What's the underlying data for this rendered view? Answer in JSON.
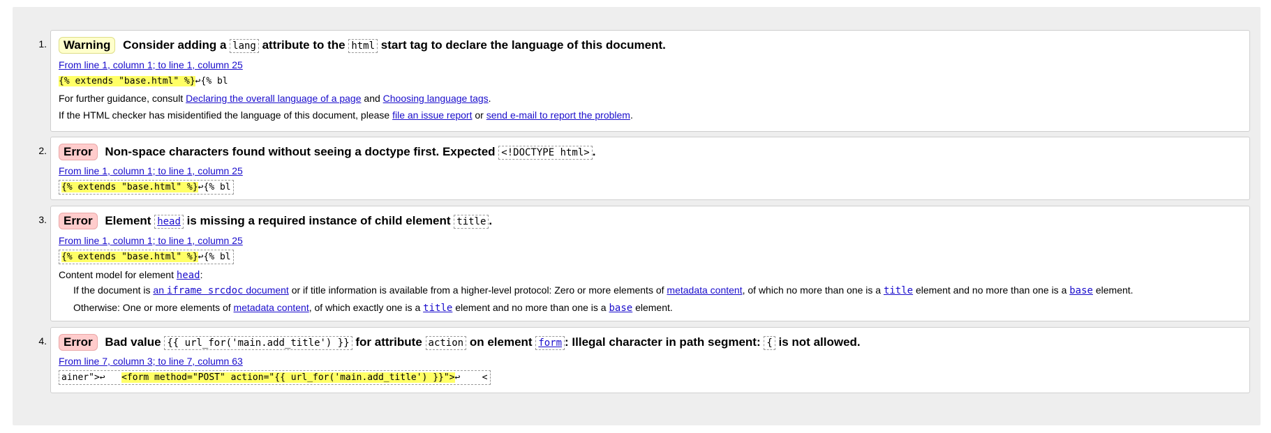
{
  "messages": [
    {
      "number": "1.",
      "type_label": "Warning",
      "title_a": "Consider adding a",
      "code1": "lang",
      "title_b": "attribute to the",
      "code2": "html",
      "title_c": "start tag to declare the language of this document.",
      "location": "From line 1, column 1; to line 1, column 25",
      "extract_highlight": "{% extends \"base.html\" %}",
      "extract_rest": "↩{% bl",
      "guidance_prefix": "For further guidance, consult",
      "guidance_link1": "Declaring the overall language of a page",
      "guidance_and": "and",
      "guidance_link2": "Choosing language tags",
      "guidance_end": ".",
      "misid_prefix": "If the HTML checker has misidentified the language of this document, please",
      "misid_link1": "file an issue report",
      "misid_or": "or",
      "misid_link2": "send e-mail to report the problem",
      "misid_end": "."
    },
    {
      "number": "2.",
      "type_label": "Error",
      "title_a": "Non-space characters found without seeing a doctype first. Expected",
      "code1": "<!DOCTYPE html>",
      "title_end": ".",
      "location": "From line 1, column 1; to line 1, column 25",
      "extract_highlight": "{% extends \"base.html\" %}",
      "extract_rest": "↩{% bl"
    },
    {
      "number": "3.",
      "type_label": "Error",
      "title_a": "Element",
      "code1": "head",
      "title_b": "is missing a required instance of child element",
      "code2": "title",
      "title_end": ".",
      "location": "From line 1, column 1; to line 1, column 25",
      "extract_highlight": "{% extends \"base.html\" %}",
      "extract_rest": "↩{% bl",
      "content_model_prefix": "Content model for element",
      "content_model_code": "head",
      "content_model_end": ":",
      "cm1_a": "If the document is",
      "cm1_link_a": "an",
      "cm1_link_code": "iframe srcdoc",
      "cm1_link_b": "document",
      "cm1_b": "or if title information is available from a higher-level protocol: Zero or more elements of",
      "cm1_link2": "metadata content",
      "cm1_c": ", of which no more than one is a",
      "cm1_code_title": "title",
      "cm1_d": "element and no more than one is a",
      "cm1_code_base": "base",
      "cm1_e": "element.",
      "cm2_a": "Otherwise: One or more elements of",
      "cm2_link": "metadata content",
      "cm2_b": ", of which exactly one is a",
      "cm2_code_title": "title",
      "cm2_c": "element and no more than one is a",
      "cm2_code_base": "base",
      "cm2_d": "element."
    },
    {
      "number": "4.",
      "type_label": "Error",
      "title_a": "Bad value",
      "code1": "{{ url_for('main.add_title') }}",
      "title_b": "for attribute",
      "code2": "action",
      "title_c": "on element",
      "code3": "form",
      "title_d": ": Illegal character in path segment:",
      "code4": "{",
      "title_e": "is not allowed.",
      "location": "From line 7, column 3; to line 7, column 63",
      "extract_pre": "ainer\">↩   ",
      "extract_highlight": "<form method=\"POST\" action=\"{{ url_for('main.add_title') }}\">",
      "extract_rest": "↩    <"
    }
  ]
}
